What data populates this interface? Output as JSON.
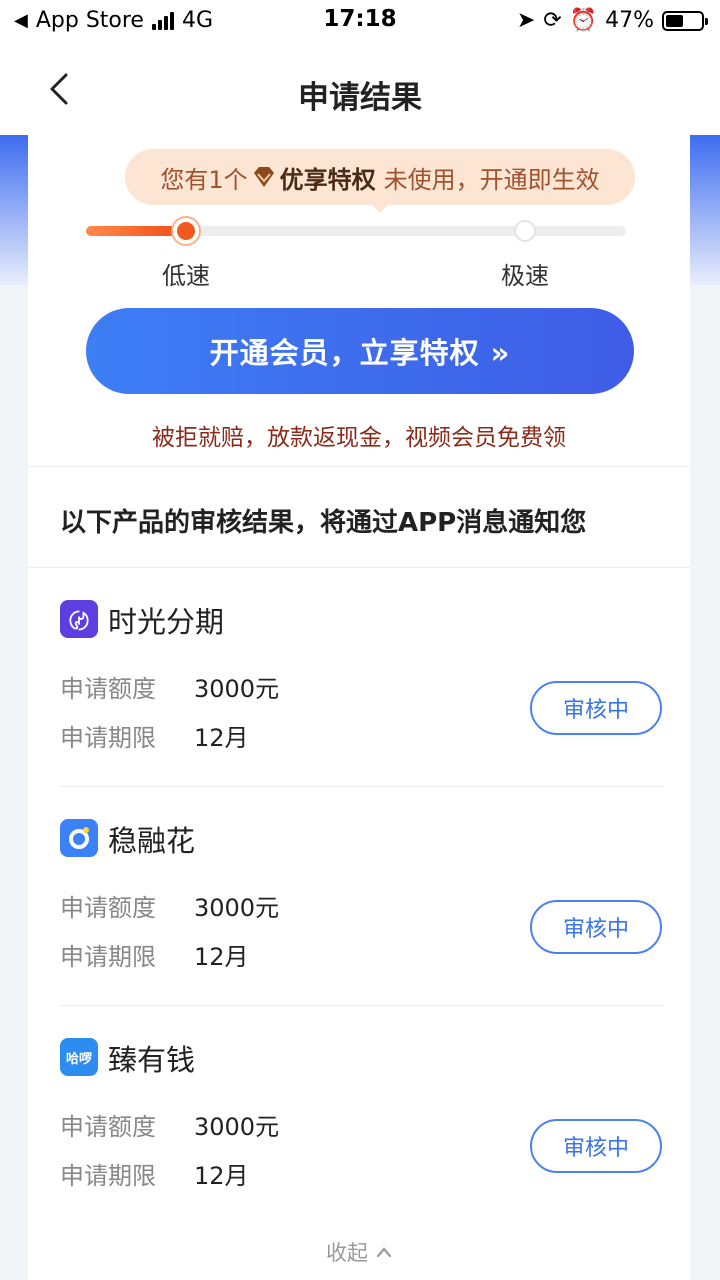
{
  "status_bar": {
    "back_app": "App Store",
    "network": "4G",
    "time": "17:18",
    "battery": "47%"
  },
  "nav": {
    "title": "申请结果"
  },
  "privilege": {
    "prefix": "您有1个",
    "name": "优享特权",
    "suffix": "未使用，开通即生效"
  },
  "speed_slider": {
    "low_label": "低速",
    "high_label": "极速",
    "level": 0.15
  },
  "vip_button": {
    "label": "开通会员，立享特权 »"
  },
  "promo": {
    "text": "被拒就赔，放款返现金，视频会员免费领"
  },
  "notice": {
    "text": "以下产品的审核结果，将通过APP消息通知您"
  },
  "products": [
    {
      "name": "时光分期",
      "amount_label": "申请额度",
      "amount": "3000元",
      "term_label": "申请期限",
      "term": "12月",
      "status": "审核中",
      "logo_color": "#5b3fe0",
      "logo_glyph": "〄"
    },
    {
      "name": "稳融花",
      "amount_label": "申请额度",
      "amount": "3000元",
      "term_label": "申请期限",
      "term": "12月",
      "status": "审核中",
      "logo_color": "#3b82f6",
      "logo_glyph": "O"
    },
    {
      "name": "臻有钱",
      "amount_label": "申请额度",
      "amount": "3000元",
      "term_label": "申请期限",
      "term": "12月",
      "status": "审核中",
      "logo_color": "#2d8cf0",
      "logo_glyph": "哈啰"
    }
  ],
  "collapse": {
    "label": "收起"
  },
  "colors": {
    "accent": "#3f6ff0",
    "orange": "#f05a1e",
    "promo": "#8a2b1a"
  }
}
